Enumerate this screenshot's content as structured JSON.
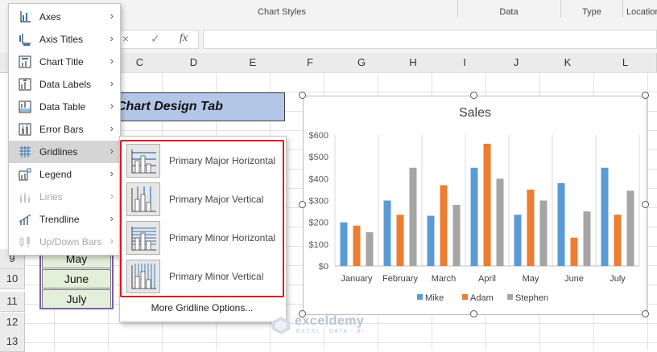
{
  "ribbon": {
    "groups": [
      "Chart Styles",
      "Data",
      "Type",
      "Location"
    ]
  },
  "formula_bar": {
    "cancel_icon": "×",
    "confirm_icon": "✓",
    "fx_icon": "fx"
  },
  "columns": [
    "C",
    "D",
    "E",
    "F",
    "G",
    "H",
    "I",
    "J",
    "K",
    "L"
  ],
  "rows": [
    "9",
    "10",
    "11",
    "12",
    "13"
  ],
  "sheet": {
    "banner_text": "Chart Design Tab",
    "month_cells": [
      "May",
      "June",
      "July"
    ]
  },
  "menu": {
    "items": [
      {
        "label": "Axes",
        "icon": "axes-icon",
        "disabled": false
      },
      {
        "label": "Axis Titles",
        "icon": "axis-titles-icon",
        "disabled": false
      },
      {
        "label": "Chart Title",
        "icon": "chart-title-icon",
        "disabled": false
      },
      {
        "label": "Data Labels",
        "icon": "data-labels-icon",
        "disabled": false
      },
      {
        "label": "Data Table",
        "icon": "data-table-icon",
        "disabled": false
      },
      {
        "label": "Error Bars",
        "icon": "error-bars-icon",
        "disabled": false
      },
      {
        "label": "Gridlines",
        "icon": "gridlines-icon",
        "disabled": false,
        "active": true
      },
      {
        "label": "Legend",
        "icon": "legend-icon",
        "disabled": false
      },
      {
        "label": "Lines",
        "icon": "lines-icon",
        "disabled": true
      },
      {
        "label": "Trendline",
        "icon": "trendline-icon",
        "disabled": false
      },
      {
        "label": "Up/Down Bars",
        "icon": "up-down-bars-icon",
        "disabled": true
      }
    ],
    "arrow": "›"
  },
  "submenu": {
    "items": [
      {
        "label": "Primary Major Horizontal",
        "icon": "major-horizontal-gridlines-icon"
      },
      {
        "label": "Primary Major Vertical",
        "icon": "major-vertical-gridlines-icon"
      },
      {
        "label": "Primary Minor Horizontal",
        "icon": "minor-horizontal-gridlines-icon"
      },
      {
        "label": "Primary Minor Vertical",
        "icon": "minor-vertical-gridlines-icon"
      }
    ],
    "more_label": "More Gridline Options..."
  },
  "chart_data": {
    "type": "bar",
    "title": "Sales",
    "categories": [
      "January",
      "February",
      "March",
      "April",
      "May",
      "June",
      "July"
    ],
    "series": [
      {
        "name": "Mike",
        "color": "#5b9bd5",
        "values": [
          200,
          300,
          230,
          450,
          235,
          380,
          450
        ]
      },
      {
        "name": "Adam",
        "color": "#ed7d31",
        "values": [
          185,
          235,
          370,
          560,
          350,
          130,
          235
        ]
      },
      {
        "name": "Stephen",
        "color": "#a5a5a5",
        "values": [
          155,
          450,
          280,
          400,
          300,
          250,
          345
        ]
      }
    ],
    "ylim": [
      0,
      600
    ],
    "yticks": [
      "$0",
      "$100",
      "$200",
      "$300",
      "$400",
      "$500",
      "$600"
    ],
    "grid": "vertical",
    "legend": "bottom"
  },
  "watermark": {
    "name": "exceldemy",
    "tagline": "EXCEL · DATA · BI"
  }
}
